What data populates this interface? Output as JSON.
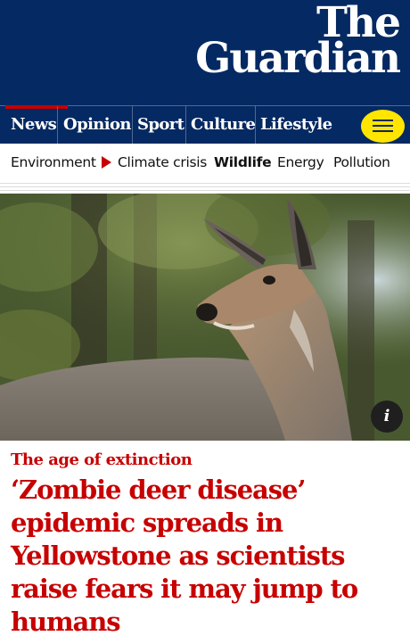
{
  "masthead": {
    "logo_line1": "The",
    "logo_line2": "Guardian"
  },
  "pillars": [
    {
      "label": "News",
      "active": true
    },
    {
      "label": "Opinion",
      "active": false
    },
    {
      "label": "Sport",
      "active": false
    },
    {
      "label": "Culture",
      "active": false
    },
    {
      "label": "Lifestyle",
      "active": false
    }
  ],
  "menu": {
    "icon": "hamburger-menu-icon"
  },
  "subnav": {
    "items": [
      "Environment",
      "Climate crisis",
      "Wildlife",
      "Energy",
      "Pollution"
    ],
    "current": "Wildlife",
    "separator_icon": "red-triangle-icon"
  },
  "hero": {
    "subject": "mule deer photo",
    "info_label": "i"
  },
  "article": {
    "kicker": "The age of extinction",
    "headline": "‘Zombie deer disease’ epidemic spreads in Yellowstone as scientists raise fears it may jump to humans"
  },
  "colors": {
    "brand_blue": "#052962",
    "news_red": "#c70000",
    "menu_yellow": "#ffe500"
  }
}
